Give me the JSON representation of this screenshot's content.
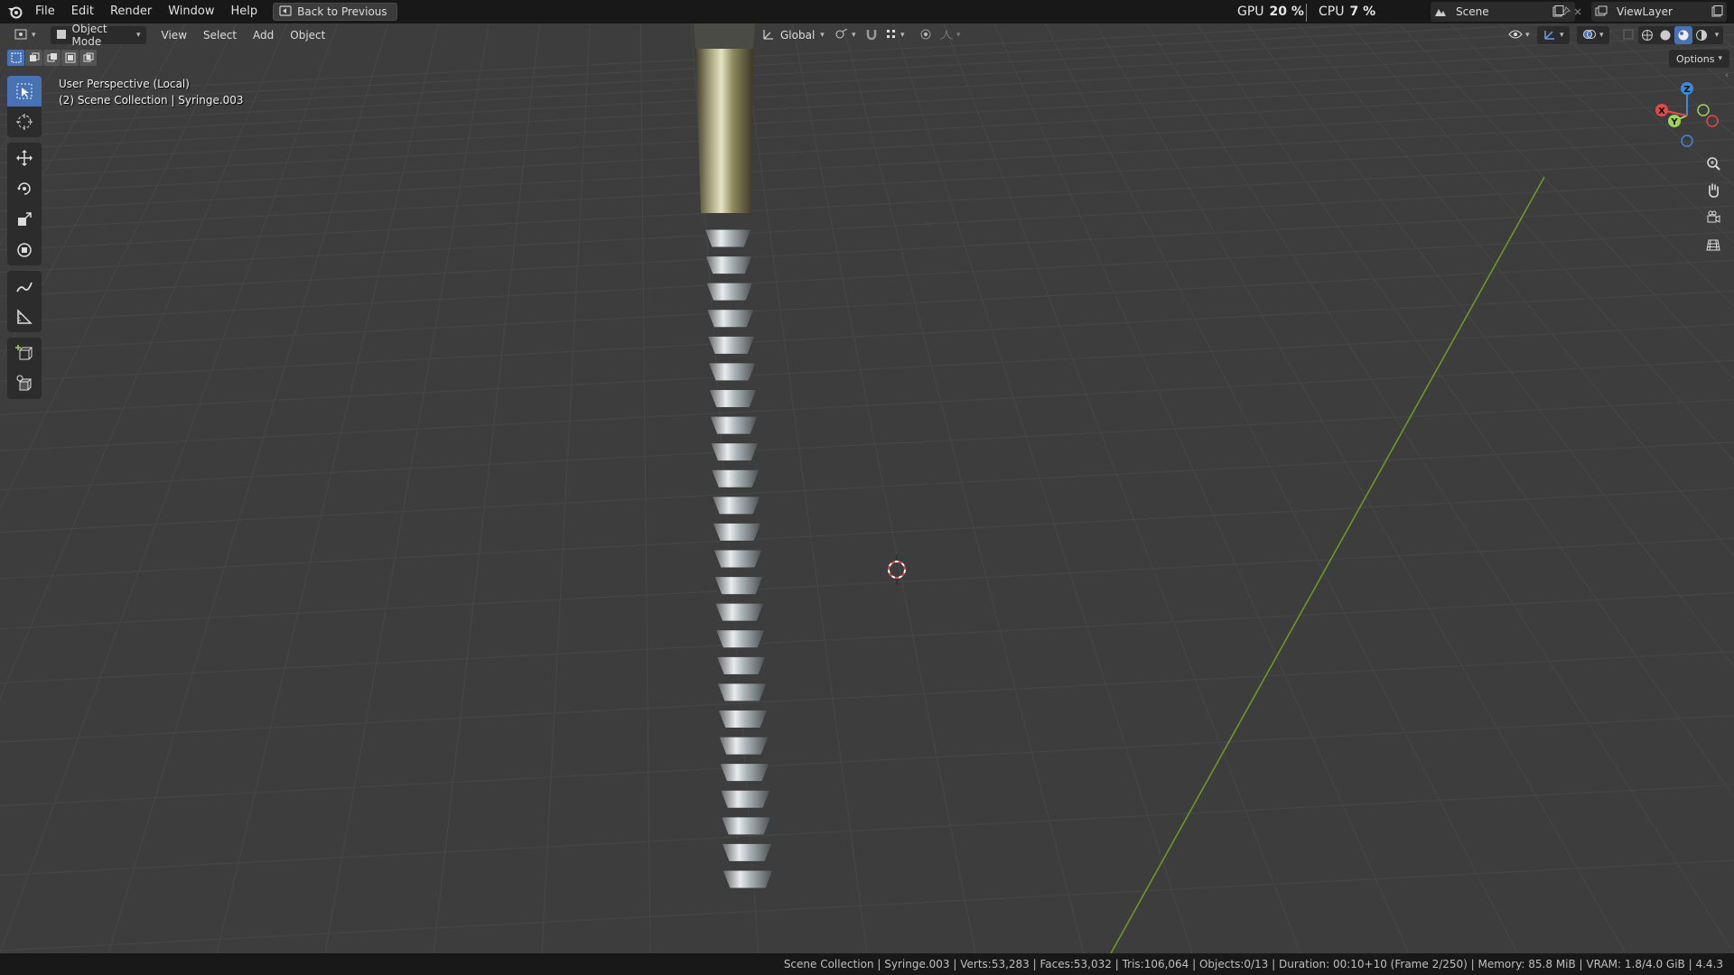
{
  "menubar": {
    "items": [
      "File",
      "Edit",
      "Render",
      "Window",
      "Help"
    ],
    "back_button": "Back to Previous"
  },
  "perf": {
    "gpu_label": "GPU",
    "gpu_value": "20 %",
    "cpu_label": "CPU",
    "cpu_value": "7 %"
  },
  "scene": {
    "name": "Scene"
  },
  "view_layer": {
    "name": "ViewLayer"
  },
  "viewport_header": {
    "mode": "Object Mode",
    "menus": [
      "View",
      "Select",
      "Add",
      "Object"
    ],
    "transform_orientation": "Global",
    "options_label": "Options"
  },
  "overlay": {
    "perspective": "User Perspective (Local)",
    "collection": "(2) Scene Collection | Syringe.003"
  },
  "gizmo": {
    "x": "X",
    "y": "Y",
    "z": "Z"
  },
  "statusbar": {
    "text": "Scene Collection | Syringe.003 | Verts:53,283 | Faces:53,032 | Tris:106,064 | Objects:0/13 | Duration: 00:10+10 (Frame 2/250) | Memory: 85.8 MiB | VRAM: 1.8/4.0 GiB | 4.4.3"
  },
  "colors": {
    "accent": "#4772b3",
    "viewport_bg": "#3d3d3d",
    "axis_green": "#6a9a23",
    "axis_red": "#e54a4a",
    "axis_blue": "#3b8bd8"
  }
}
